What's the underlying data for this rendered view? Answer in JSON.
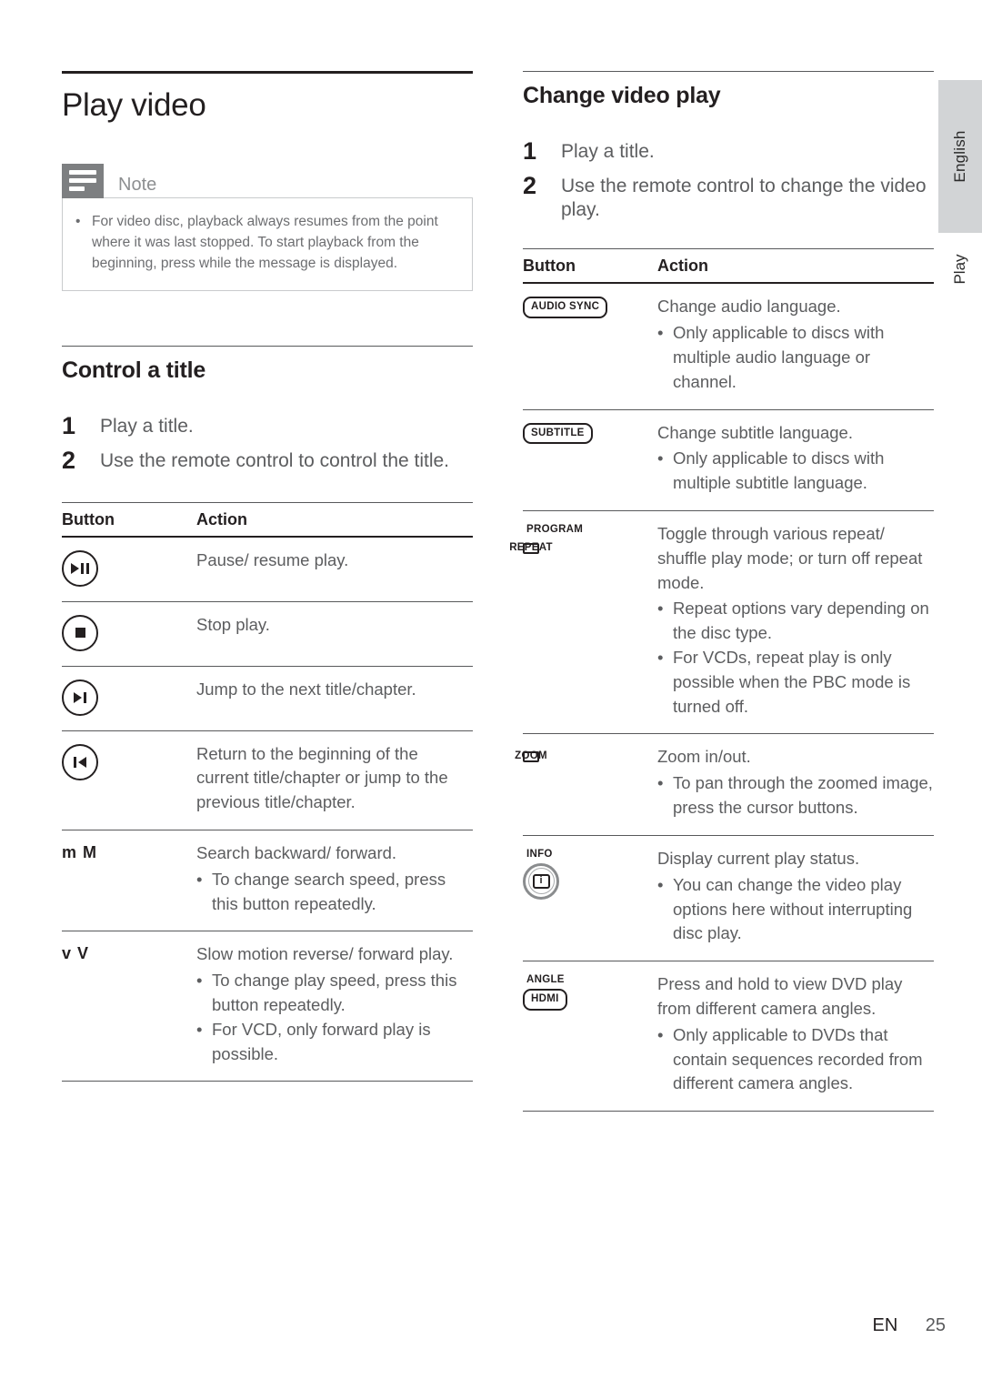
{
  "side_tab": {
    "language_label": "English",
    "section_label": "Play"
  },
  "footer": {
    "lang_code": "EN",
    "page_number": "25"
  },
  "left_column": {
    "title": "Play video",
    "note": {
      "icon": "note-lines-icon",
      "label": "Note",
      "items": [
        "For video disc, playback always resumes from the point where it was last stopped. To start playback from the beginning, press      while the message is displayed."
      ]
    },
    "section": {
      "heading": "Control a title",
      "steps": [
        {
          "num": "1",
          "text": "Play a title."
        },
        {
          "num": "2",
          "text": "Use the remote control to control the title."
        }
      ],
      "table": {
        "headers": [
          "Button",
          "Action"
        ],
        "rows": [
          {
            "button_kind": "circle-play-pause",
            "button_icon": "play-pause-icon",
            "button_text": "",
            "action": "Pause/ resume play.",
            "bullets": []
          },
          {
            "button_kind": "circle-stop",
            "button_icon": "stop-icon",
            "button_text": "",
            "action": "Stop play.",
            "bullets": []
          },
          {
            "button_kind": "circle-next",
            "button_icon": "next-track-icon",
            "button_text": "",
            "action": "Jump to the next title/chapter.",
            "bullets": []
          },
          {
            "button_kind": "circle-prev",
            "button_icon": "previous-track-icon",
            "button_text": "",
            "action": "Return to the beginning of the current title/chapter or jump to the previous title/chapter.",
            "bullets": []
          },
          {
            "button_kind": "keytext",
            "button_icon": "search-keys-icon",
            "button_text": "m  M",
            "action": "Search backward/ forward.",
            "bullets": [
              "To change search speed, press this button repeatedly."
            ]
          },
          {
            "button_kind": "keytext",
            "button_icon": "slow-motion-keys-icon",
            "button_text": "v V",
            "action": "Slow motion reverse/ forward play.",
            "bullets": [
              "To change play speed, press this button repeatedly.",
              "For VCD, only forward play is possible."
            ]
          }
        ]
      }
    }
  },
  "right_column": {
    "section": {
      "heading": "Change video play",
      "steps": [
        {
          "num": "1",
          "text": "Play a title."
        },
        {
          "num": "2",
          "text": "Use the remote control to change the video play."
        }
      ],
      "table": {
        "headers": [
          "Button",
          "Action"
        ],
        "rows": [
          {
            "button_kind": "badge-round",
            "button_icon": "audio-sync-button-icon",
            "plain_label": "",
            "badge_label": "AUDIO SYNC",
            "action": "Change audio language.",
            "bullets": [
              "Only applicable to discs with multiple audio language or channel."
            ]
          },
          {
            "button_kind": "badge-round",
            "button_icon": "subtitle-button-icon",
            "plain_label": "",
            "badge_label": "SUBTITLE",
            "action": "Change subtitle language.",
            "bullets": [
              "Only applicable to discs with multiple subtitle language."
            ]
          },
          {
            "button_kind": "label-plus-badge-square",
            "button_icon": "program-repeat-button-icon",
            "plain_label": "PROGRAM",
            "badge_label": "REPEAT",
            "action": "Toggle through various repeat/ shuffle play mode; or turn off repeat mode.",
            "bullets": [
              "Repeat options vary depending on the disc type.",
              "For VCDs, repeat play is only possible when the PBC mode is turned off."
            ]
          },
          {
            "button_kind": "badge-square",
            "button_icon": "zoom-button-icon",
            "plain_label": "",
            "badge_label": "ZOOM",
            "action": "Zoom in/out.",
            "bullets": [
              "To pan through the zoomed image, press the cursor buttons."
            ]
          },
          {
            "button_kind": "label-plus-info-circle",
            "button_icon": "info-button-icon",
            "plain_label": "INFO",
            "badge_label": "i",
            "action": "Display current play status.",
            "bullets": [
              "You can change the video play options here without interrupting disc play."
            ]
          },
          {
            "button_kind": "label-plus-badge-round",
            "button_icon": "angle-hdmi-button-icon",
            "plain_label": "ANGLE",
            "badge_label": "HDMI",
            "action": "Press and hold to view DVD play from different camera angles.",
            "bullets": [
              "Only applicable to DVDs that contain sequences recorded from different camera angles."
            ]
          }
        ]
      }
    }
  },
  "colors": {
    "ink": "#231f20",
    "body_text": "#5c5d5f",
    "note_gray": "#7d7f81",
    "tab_gray": "#d2d4d6"
  }
}
